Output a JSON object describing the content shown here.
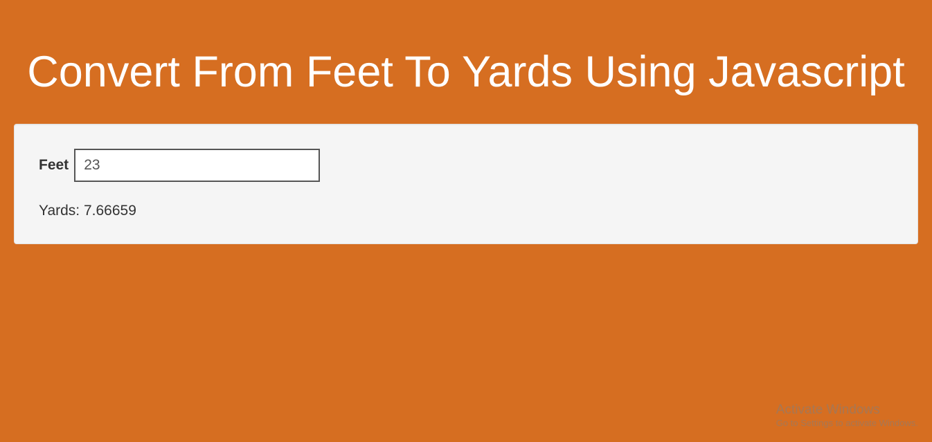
{
  "header": {
    "title": "Convert From Feet To Yards Using Javascript"
  },
  "form": {
    "feet_label": "Feet",
    "feet_value": "23"
  },
  "output": {
    "yards_label": "Yards:",
    "yards_value": "7.66659"
  },
  "watermark": {
    "title": "Activate Windows",
    "sub": "Go to Settings to activate Windows."
  }
}
